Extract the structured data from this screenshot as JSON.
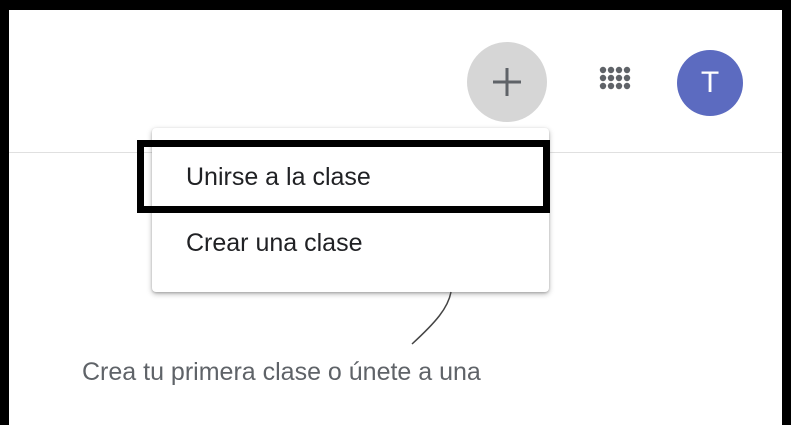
{
  "header": {
    "add_icon": "plus-icon",
    "apps_icon": "apps-grid-icon",
    "avatar_initial": "T",
    "avatar_color": "#5c6bc0"
  },
  "menu": {
    "items": [
      {
        "label": "Unirse a la clase",
        "highlighted": true
      },
      {
        "label": "Crear una clase",
        "highlighted": false
      }
    ]
  },
  "empty_state": {
    "text": "Crea tu primera clase o únete a una"
  },
  "colors": {
    "add_button_bg": "#d6d6d6",
    "highlight_border": "#000000",
    "divider": "#e0e0e0"
  }
}
